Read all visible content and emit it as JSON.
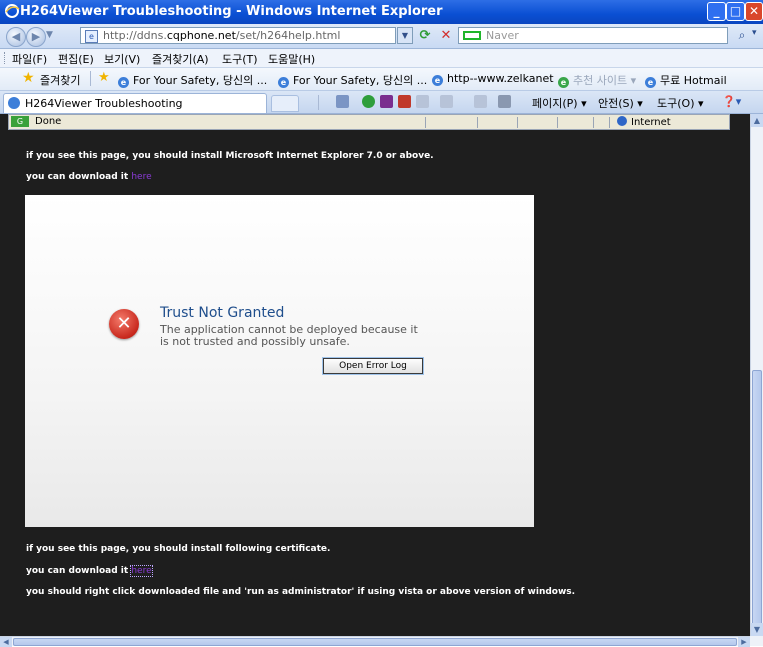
{
  "window": {
    "title": "H264Viewer Troubleshooting - Windows Internet Explorer",
    "min_glyph": "_",
    "max_glyph": "□",
    "close_glyph": "✕"
  },
  "address_bar": {
    "url_prefix": "http://ddns.",
    "url_domain": "cqphone.net",
    "url_suffix": "/set/h264help.html",
    "search_placeholder": "Naver"
  },
  "menu": {
    "items": [
      "파일(F)",
      "편집(E)",
      "보기(V)",
      "즐겨찾기(A)",
      "도구(T)",
      "도움말(H)"
    ]
  },
  "favorites": {
    "label": "즐겨찾기",
    "items": [
      "For Your Safety, 당신의 ...",
      "For Your Safety, 당신의 ...",
      "http--www.zelkanet",
      "추천 사이트",
      "무료 Hotmail"
    ]
  },
  "tab": {
    "label": "H264Viewer Troubleshooting"
  },
  "commands": {
    "page": "페이지(P)",
    "safety": "안전(S)",
    "tools": "도구(O)"
  },
  "status": {
    "text": "Done",
    "zone": "Internet"
  },
  "content": {
    "line1": "if you see this page, you should install Microsoft Internet Explorer 7.0 or above.",
    "line2_prefix": "you can download it",
    "line2_link": "here",
    "line3": "if you see this page, you should install following certificate.",
    "line4_prefix": "you can download it",
    "line4_link": "here",
    "line5": "you should right click downloaded file and 'run as administrator' if using vista or above version of windows."
  },
  "dialog": {
    "title": "Trust Not Granted",
    "message_line1": "The application cannot be deployed because it",
    "message_line2": "is not trusted and possibly unsafe.",
    "button": "Open Error Log"
  }
}
